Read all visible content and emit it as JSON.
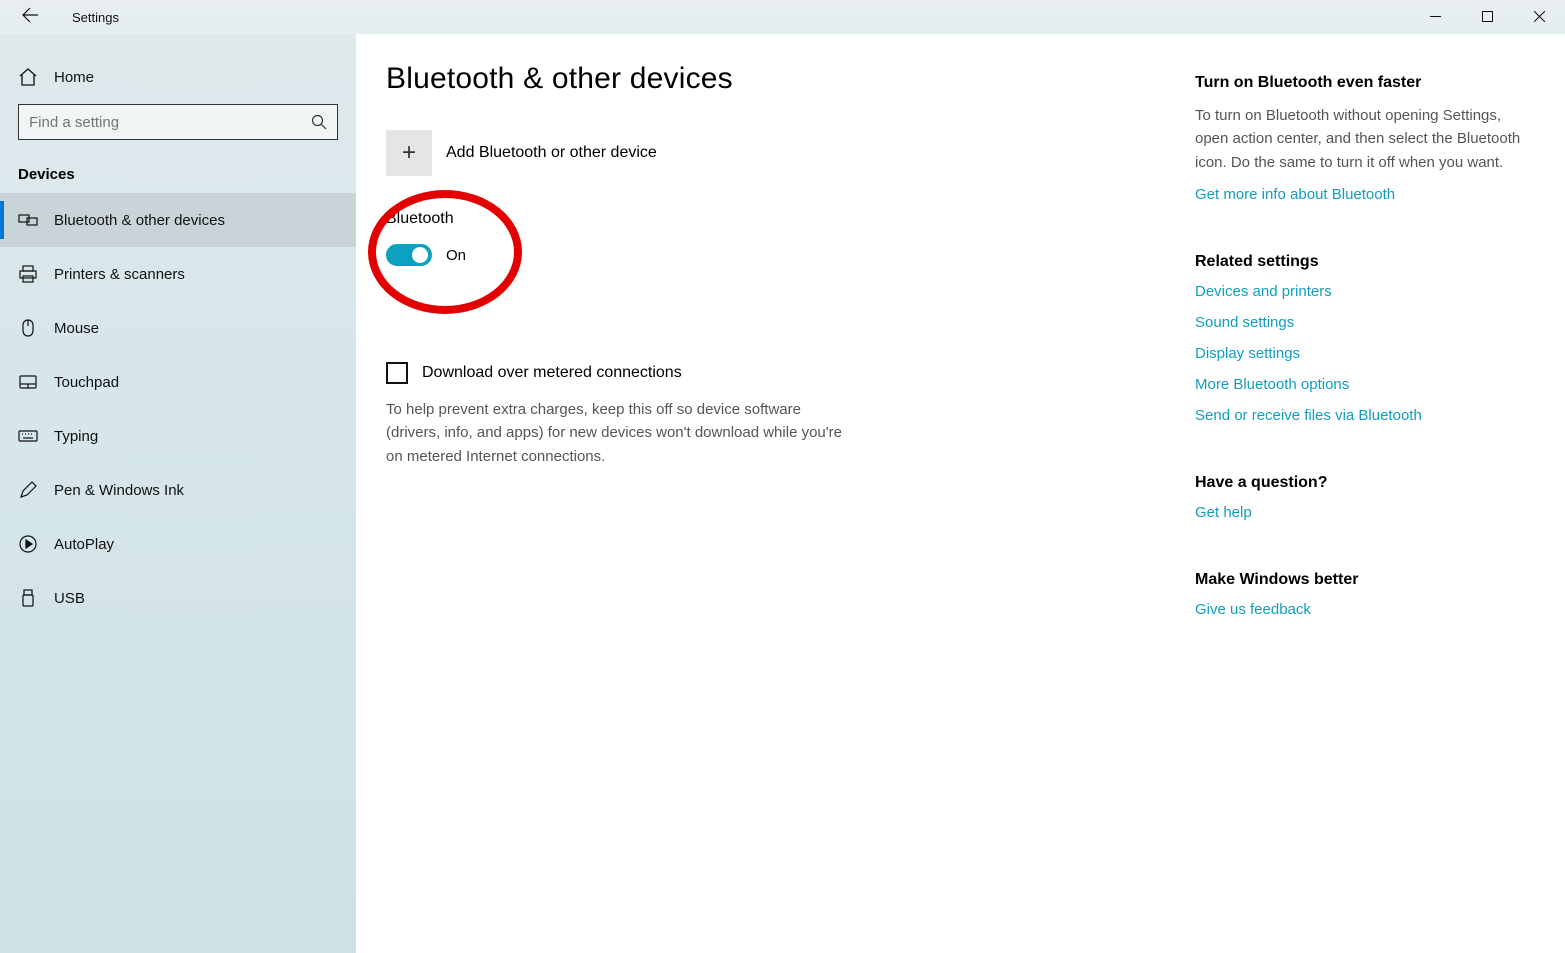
{
  "window_title": "Settings",
  "sidebar": {
    "home_label": "Home",
    "search_placeholder": "Find a setting",
    "section_title": "Devices",
    "items": [
      {
        "label": "Bluetooth & other devices"
      },
      {
        "label": "Printers & scanners"
      },
      {
        "label": "Mouse"
      },
      {
        "label": "Touchpad"
      },
      {
        "label": "Typing"
      },
      {
        "label": "Pen & Windows Ink"
      },
      {
        "label": "AutoPlay"
      },
      {
        "label": "USB"
      }
    ]
  },
  "main": {
    "title": "Bluetooth & other devices",
    "add_label": "Add Bluetooth or other device",
    "bt_heading": "Bluetooth",
    "bt_state": "On",
    "metered_checkbox_label": "Download over metered connections",
    "metered_desc": "To help prevent extra charges, keep this off so device software (drivers, info, and apps) for new devices won't download while you're on metered Internet connections."
  },
  "right": {
    "faster_heading": "Turn on Bluetooth even faster",
    "faster_text": "To turn on Bluetooth without opening Settings, open action center, and then select the Bluetooth icon. Do the same to turn it off when you want.",
    "faster_link": "Get more info about Bluetooth",
    "related_heading": "Related settings",
    "related_links": {
      "devices": "Devices and printers",
      "sound": "Sound settings",
      "display": "Display settings",
      "more_bt": "More Bluetooth options",
      "send_receive": "Send or receive files via Bluetooth"
    },
    "question_heading": "Have a question?",
    "question_link": "Get help",
    "feedback_heading": "Make Windows better",
    "feedback_link": "Give us feedback"
  }
}
